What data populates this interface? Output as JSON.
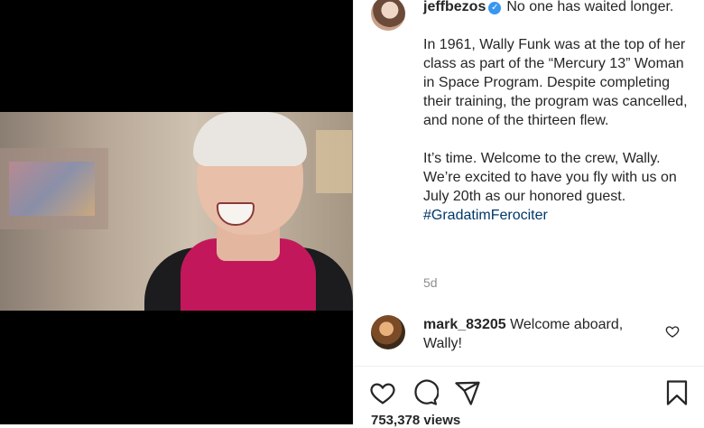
{
  "post": {
    "username": "jeffbezos",
    "verified_icon": "verified-badge-icon",
    "caption_first": "No one has waited longer.",
    "caption_p2": "In 1961, Wally Funk was at the top of her class as part of the “Mercury 13” Woman in Space Program. Despite completing their training, the program was cancelled, and none of the thirteen flew.",
    "caption_p3_text": "It’s time. Welcome to the crew, Wally. We’re excited to have you fly with us on July 20th as our honored guest.",
    "hashtag": "#GradatimFerociter",
    "age": "5d"
  },
  "comment": {
    "username": "mark_83205",
    "text": "Welcome aboard, Wally!"
  },
  "actions": {
    "like_icon": "heart-icon",
    "comment_icon": "comment-bubble-icon",
    "share_icon": "paper-plane-icon",
    "save_icon": "bookmark-icon"
  },
  "stats": {
    "views": "753,378 views"
  },
  "colors": {
    "text": "#262626",
    "muted": "#8e8e8e",
    "verified": "#3897f0",
    "hashtag": "#00376b"
  }
}
